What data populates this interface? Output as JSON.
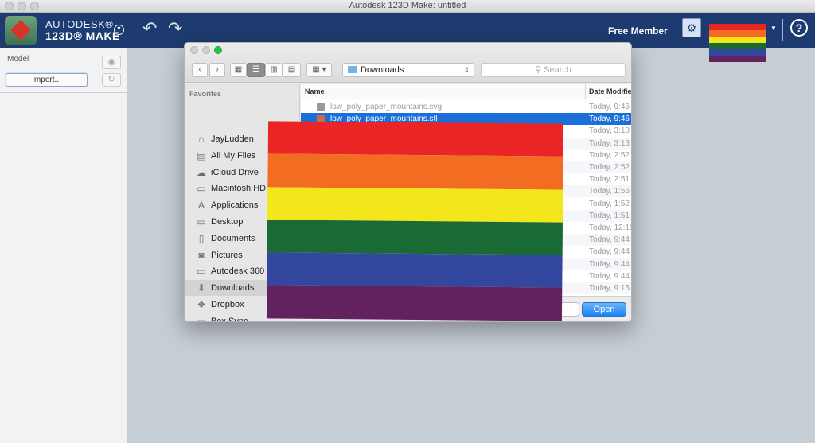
{
  "window": {
    "title": "Autodesk 123D Make: untitled"
  },
  "app": {
    "brand_line1": "AUTODESK®",
    "brand_line2": "123D® MAKE",
    "member_label": "Free Member"
  },
  "left_panel": {
    "model_label": "Model",
    "import_label": "Import..."
  },
  "dialog": {
    "location": "Downloads",
    "search_placeholder": "Search",
    "favorites_title": "Favorites",
    "favorites": [
      {
        "label": "JayLudden",
        "icon": "home-icon"
      },
      {
        "label": "All My Files",
        "icon": "files-icon"
      },
      {
        "label": "iCloud Drive",
        "icon": "cloud-icon"
      },
      {
        "label": "Macintosh HD",
        "icon": "disk-icon"
      },
      {
        "label": "Applications",
        "icon": "applications-icon"
      },
      {
        "label": "Desktop",
        "icon": "desktop-icon"
      },
      {
        "label": "Documents",
        "icon": "documents-icon"
      },
      {
        "label": "Pictures",
        "icon": "camera-icon"
      },
      {
        "label": "Autodesk 360",
        "icon": "folder-icon"
      },
      {
        "label": "Downloads",
        "icon": "downloads-icon"
      },
      {
        "label": "Dropbox",
        "icon": "dropbox-icon"
      },
      {
        "label": "Box Sync",
        "icon": "folder-icon"
      }
    ],
    "columns": {
      "name": "Name",
      "date": "Date Modifie"
    },
    "files": [
      {
        "name": "low_poly_paper_mountains.svg",
        "date": "Today, 9:46"
      },
      {
        "name": "low_poly_paper_mountains.stl",
        "date": "Today, 9:46"
      },
      {
        "name": "",
        "date": "Today, 3:18"
      },
      {
        "name": "",
        "date": "Today, 3:13"
      },
      {
        "name": "",
        "date": "Today, 2:52"
      },
      {
        "name": "",
        "date": "Today, 2:52"
      },
      {
        "name": "",
        "date": "Today, 2:51"
      },
      {
        "name": "",
        "date": "Today, 1:56"
      },
      {
        "name": "",
        "date": "Today, 1:52"
      },
      {
        "name": "",
        "date": "Today, 1:51"
      },
      {
        "name": "",
        "date": "Today, 12:19"
      },
      {
        "name": "",
        "date": "Today, 9:44"
      },
      {
        "name": "",
        "date": "Today, 9:44"
      },
      {
        "name": "",
        "date": "Today, 9:44"
      },
      {
        "name": "",
        "date": "Today, 9:44"
      },
      {
        "name": "",
        "date": "Today, 9:15"
      }
    ],
    "cancel_label": "el",
    "open_label": "Open"
  },
  "flag_colors": [
    "#ea2525",
    "#f26c22",
    "#f3e71c",
    "#196a34",
    "#33479f",
    "#62215f"
  ]
}
